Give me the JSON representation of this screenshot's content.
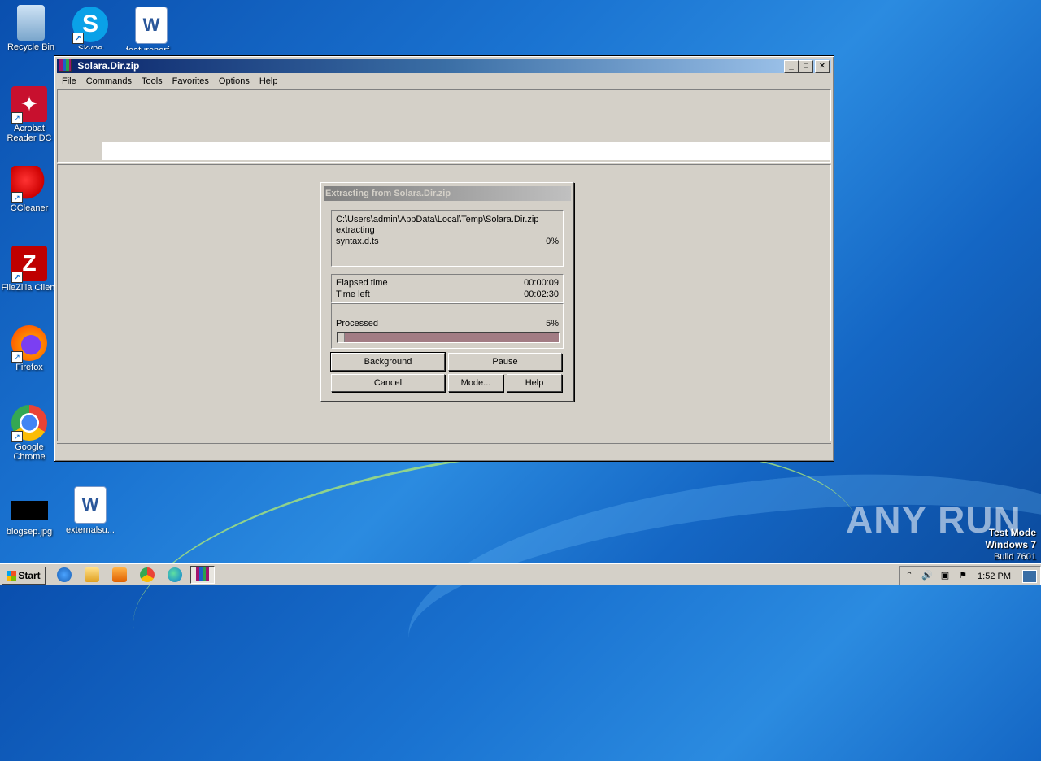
{
  "desktop": {
    "icons": [
      {
        "label": "Recycle Bin",
        "icon": "recycle-bin-icon"
      },
      {
        "label": "Skype",
        "icon": "skype-icon"
      },
      {
        "label": "featureperf...",
        "icon": "word-doc-icon"
      },
      {
        "label": "Acrobat Reader DC",
        "icon": "acrobat-icon"
      },
      {
        "label": "CCleaner",
        "icon": "ccleaner-icon"
      },
      {
        "label": "FileZilla Client",
        "icon": "filezilla-icon"
      },
      {
        "label": "Firefox",
        "icon": "firefox-icon"
      },
      {
        "label": "Google Chrome",
        "icon": "chrome-icon"
      },
      {
        "label": "blogsep.jpg",
        "icon": "image-file-icon"
      },
      {
        "label": "externalsu...",
        "icon": "word-doc-icon"
      }
    ],
    "watermark": "ANY RUN",
    "test_mode": {
      "line1": "Test Mode",
      "line2": "Windows 7",
      "line3": "Build 7601"
    }
  },
  "window": {
    "title": "Solara.Dir.zip",
    "menu": [
      "File",
      "Commands",
      "Tools",
      "Favorites",
      "Options",
      "Help"
    ]
  },
  "dialog": {
    "title": "Extracting from Solara.Dir.zip",
    "archive_path": "C:\\Users\\admin\\AppData\\Local\\Temp\\Solara.Dir.zip",
    "action": "extracting",
    "current_file": "syntax.d.ts",
    "file_percent": "0%",
    "elapsed_label": "Elapsed time",
    "elapsed_value": "00:00:09",
    "left_label": "Time left",
    "left_value": "00:02:30",
    "processed_label": "Processed",
    "processed_percent": "5%",
    "progress_fraction": 0.03,
    "buttons": {
      "background": "Background",
      "pause": "Pause",
      "cancel": "Cancel",
      "mode": "Mode...",
      "help": "Help"
    }
  },
  "taskbar": {
    "start_label": "Start",
    "clock": "1:52 PM"
  }
}
